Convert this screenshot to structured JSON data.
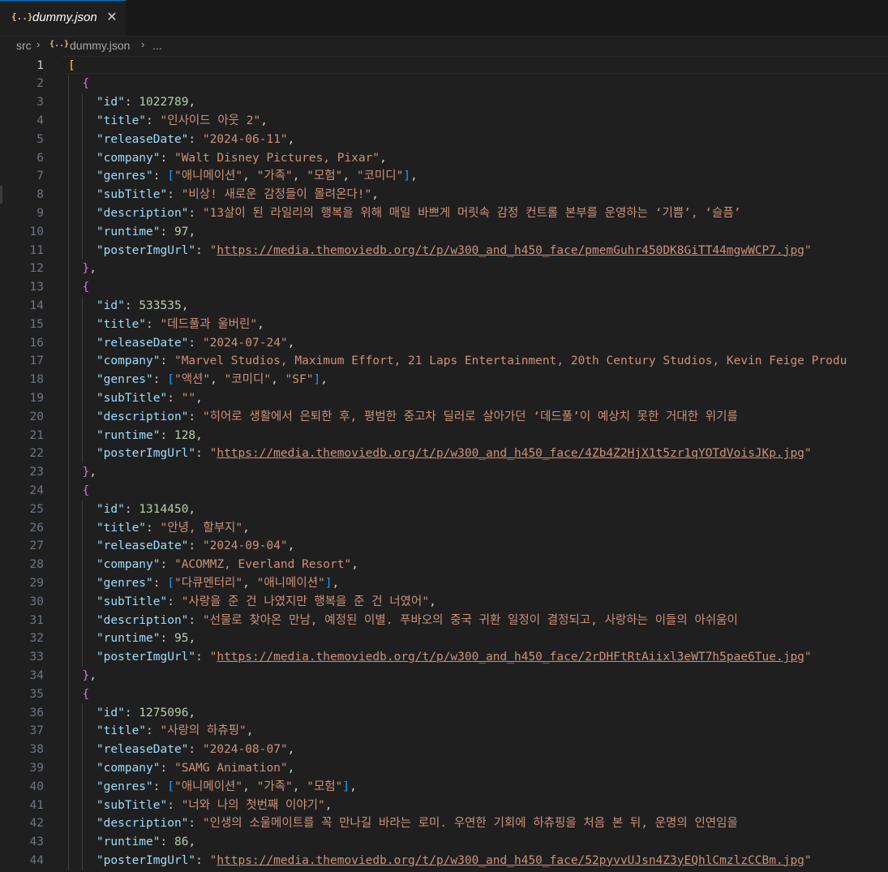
{
  "tab": {
    "icon": "{..}",
    "icon_name": "json-file-icon",
    "label": "dummy.json",
    "close_glyph": "✕"
  },
  "breadcrumb": {
    "folder": "src",
    "file": "dummy.json",
    "more": "...",
    "separator": "›"
  },
  "editor": {
    "active_line": 1,
    "lines": [
      [
        [
          "br1",
          "["
        ]
      ],
      [
        [
          "br2",
          "{"
        ]
      ],
      [
        [
          "key",
          "\"id\""
        ],
        [
          "punc",
          ": "
        ],
        [
          "num",
          "1022789"
        ],
        [
          "punc",
          ","
        ]
      ],
      [
        [
          "key",
          "\"title\""
        ],
        [
          "punc",
          ": "
        ],
        [
          "str",
          "\"인사이드 아웃 2\""
        ],
        [
          "punc",
          ","
        ]
      ],
      [
        [
          "key",
          "\"releaseDate\""
        ],
        [
          "punc",
          ": "
        ],
        [
          "str",
          "\"2024-06-11\""
        ],
        [
          "punc",
          ","
        ]
      ],
      [
        [
          "key",
          "\"company\""
        ],
        [
          "punc",
          ": "
        ],
        [
          "str",
          "\"Walt Disney Pictures, Pixar\""
        ],
        [
          "punc",
          ","
        ]
      ],
      [
        [
          "key",
          "\"genres\""
        ],
        [
          "punc",
          ": "
        ],
        [
          "br3",
          "["
        ],
        [
          "str",
          "\"애니메이션\""
        ],
        [
          "punc",
          ", "
        ],
        [
          "str",
          "\"가족\""
        ],
        [
          "punc",
          ", "
        ],
        [
          "str",
          "\"모험\""
        ],
        [
          "punc",
          ", "
        ],
        [
          "str",
          "\"코미디\""
        ],
        [
          "br3",
          "]"
        ],
        [
          "punc",
          ","
        ]
      ],
      [
        [
          "key",
          "\"subTitle\""
        ],
        [
          "punc",
          ": "
        ],
        [
          "str",
          "\"비상! 새로운 감정들이 몰려온다!\""
        ],
        [
          "punc",
          ","
        ]
      ],
      [
        [
          "key",
          "\"description\""
        ],
        [
          "punc",
          ": "
        ],
        [
          "str",
          "\"13살이 된 라일리의 행복을 위해 매일 바쁘게 머릿속 감정 컨트롤 본부를 운영하는 ‘기쁨’, ‘슬픔’"
        ]
      ],
      [
        [
          "key",
          "\"runtime\""
        ],
        [
          "punc",
          ": "
        ],
        [
          "num",
          "97"
        ],
        [
          "punc",
          ","
        ]
      ],
      [
        [
          "key",
          "\"posterImgUrl\""
        ],
        [
          "punc",
          ": "
        ],
        [
          "str",
          "\""
        ],
        [
          "url",
          "https://media.themoviedb.org/t/p/w300_and_h450_face/pmemGuhr450DK8GiTT44mgwWCP7.jpg"
        ],
        [
          "str",
          "\""
        ]
      ],
      [
        [
          "br2",
          "}"
        ],
        [
          "punc",
          ","
        ]
      ],
      [
        [
          "br2",
          "{"
        ]
      ],
      [
        [
          "key",
          "\"id\""
        ],
        [
          "punc",
          ": "
        ],
        [
          "num",
          "533535"
        ],
        [
          "punc",
          ","
        ]
      ],
      [
        [
          "key",
          "\"title\""
        ],
        [
          "punc",
          ": "
        ],
        [
          "str",
          "\"데드풀과 울버린\""
        ],
        [
          "punc",
          ","
        ]
      ],
      [
        [
          "key",
          "\"releaseDate\""
        ],
        [
          "punc",
          ": "
        ],
        [
          "str",
          "\"2024-07-24\""
        ],
        [
          "punc",
          ","
        ]
      ],
      [
        [
          "key",
          "\"company\""
        ],
        [
          "punc",
          ": "
        ],
        [
          "str",
          "\"Marvel Studios, Maximum Effort, 21 Laps Entertainment, 20th Century Studios, Kevin Feige Produ"
        ]
      ],
      [
        [
          "key",
          "\"genres\""
        ],
        [
          "punc",
          ": "
        ],
        [
          "br3",
          "["
        ],
        [
          "str",
          "\"액션\""
        ],
        [
          "punc",
          ", "
        ],
        [
          "str",
          "\"코미디\""
        ],
        [
          "punc",
          ", "
        ],
        [
          "str",
          "\"SF\""
        ],
        [
          "br3",
          "]"
        ],
        [
          "punc",
          ","
        ]
      ],
      [
        [
          "key",
          "\"subTitle\""
        ],
        [
          "punc",
          ": "
        ],
        [
          "str",
          "\"\""
        ],
        [
          "punc",
          ","
        ]
      ],
      [
        [
          "key",
          "\"description\""
        ],
        [
          "punc",
          ": "
        ],
        [
          "str",
          "\"히어로 생활에서 은퇴한 후, 평범한 중고차 딜러로 살아가던 ‘데드풀’이 예상치 못한 거대한 위기를"
        ]
      ],
      [
        [
          "key",
          "\"runtime\""
        ],
        [
          "punc",
          ": "
        ],
        [
          "num",
          "128"
        ],
        [
          "punc",
          ","
        ]
      ],
      [
        [
          "key",
          "\"posterImgUrl\""
        ],
        [
          "punc",
          ": "
        ],
        [
          "str",
          "\""
        ],
        [
          "url",
          "https://media.themoviedb.org/t/p/w300_and_h450_face/4Zb4Z2HjX1t5zr1qYOTdVoisJKp.jpg"
        ],
        [
          "str",
          "\""
        ]
      ],
      [
        [
          "br2",
          "}"
        ],
        [
          "punc",
          ","
        ]
      ],
      [
        [
          "br2",
          "{"
        ]
      ],
      [
        [
          "key",
          "\"id\""
        ],
        [
          "punc",
          ": "
        ],
        [
          "num",
          "1314450"
        ],
        [
          "punc",
          ","
        ]
      ],
      [
        [
          "key",
          "\"title\""
        ],
        [
          "punc",
          ": "
        ],
        [
          "str",
          "\"안녕, 할부지\""
        ],
        [
          "punc",
          ","
        ]
      ],
      [
        [
          "key",
          "\"releaseDate\""
        ],
        [
          "punc",
          ": "
        ],
        [
          "str",
          "\"2024-09-04\""
        ],
        [
          "punc",
          ","
        ]
      ],
      [
        [
          "key",
          "\"company\""
        ],
        [
          "punc",
          ": "
        ],
        [
          "str",
          "\"ACOMMZ, Everland Resort\""
        ],
        [
          "punc",
          ","
        ]
      ],
      [
        [
          "key",
          "\"genres\""
        ],
        [
          "punc",
          ": "
        ],
        [
          "br3",
          "["
        ],
        [
          "str",
          "\"다큐멘터리\""
        ],
        [
          "punc",
          ", "
        ],
        [
          "str",
          "\"애니메이션\""
        ],
        [
          "br3",
          "]"
        ],
        [
          "punc",
          ","
        ]
      ],
      [
        [
          "key",
          "\"subTitle\""
        ],
        [
          "punc",
          ": "
        ],
        [
          "str",
          "\"사랑을 준 건 나였지만 행복을 준 건 너였어\""
        ],
        [
          "punc",
          ","
        ]
      ],
      [
        [
          "key",
          "\"description\""
        ],
        [
          "punc",
          ": "
        ],
        [
          "str",
          "\"선물로 찾아온 만남, 예정된 이별. 푸바오의 중국 귀환 일정이 결정되고, 사랑하는 이들의 아쉬움이"
        ]
      ],
      [
        [
          "key",
          "\"runtime\""
        ],
        [
          "punc",
          ": "
        ],
        [
          "num",
          "95"
        ],
        [
          "punc",
          ","
        ]
      ],
      [
        [
          "key",
          "\"posterImgUrl\""
        ],
        [
          "punc",
          ": "
        ],
        [
          "str",
          "\""
        ],
        [
          "url",
          "https://media.themoviedb.org/t/p/w300_and_h450_face/2rDHFtRtAiixl3eWT7h5pae6Tue.jpg"
        ],
        [
          "str",
          "\""
        ]
      ],
      [
        [
          "br2",
          "}"
        ],
        [
          "punc",
          ","
        ]
      ],
      [
        [
          "br2",
          "{"
        ]
      ],
      [
        [
          "key",
          "\"id\""
        ],
        [
          "punc",
          ": "
        ],
        [
          "num",
          "1275096"
        ],
        [
          "punc",
          ","
        ]
      ],
      [
        [
          "key",
          "\"title\""
        ],
        [
          "punc",
          ": "
        ],
        [
          "str",
          "\"사랑의 하츄핑\""
        ],
        [
          "punc",
          ","
        ]
      ],
      [
        [
          "key",
          "\"releaseDate\""
        ],
        [
          "punc",
          ": "
        ],
        [
          "str",
          "\"2024-08-07\""
        ],
        [
          "punc",
          ","
        ]
      ],
      [
        [
          "key",
          "\"company\""
        ],
        [
          "punc",
          ": "
        ],
        [
          "str",
          "\"SAMG Animation\""
        ],
        [
          "punc",
          ","
        ]
      ],
      [
        [
          "key",
          "\"genres\""
        ],
        [
          "punc",
          ": "
        ],
        [
          "br3",
          "["
        ],
        [
          "str",
          "\"애니메이션\""
        ],
        [
          "punc",
          ", "
        ],
        [
          "str",
          "\"가족\""
        ],
        [
          "punc",
          ", "
        ],
        [
          "str",
          "\"모험\""
        ],
        [
          "br3",
          "]"
        ],
        [
          "punc",
          ","
        ]
      ],
      [
        [
          "key",
          "\"subTitle\""
        ],
        [
          "punc",
          ": "
        ],
        [
          "str",
          "\"너와 나의 첫번째 이야기\""
        ],
        [
          "punc",
          ","
        ]
      ],
      [
        [
          "key",
          "\"description\""
        ],
        [
          "punc",
          ": "
        ],
        [
          "str",
          "\"인생의 소울메이트를 꼭 만나길 바라는 로미. 우연한 기회에 하츄핑을 처음 본 뒤, 운명의 인연임을"
        ]
      ],
      [
        [
          "key",
          "\"runtime\""
        ],
        [
          "punc",
          ": "
        ],
        [
          "num",
          "86"
        ],
        [
          "punc",
          ","
        ]
      ],
      [
        [
          "key",
          "\"posterImgUrl\""
        ],
        [
          "punc",
          ": "
        ],
        [
          "str",
          "\""
        ],
        [
          "url",
          "https://media.themoviedb.org/t/p/w300_and_h450_face/52pyvvUJsn4Z3yEQhlCmzlzCCBm.jpg"
        ],
        [
          "str",
          "\""
        ]
      ]
    ]
  },
  "colors": {
    "background": "#1f1f1f",
    "key": "#9cdcfe",
    "string": "#ce9178",
    "number": "#b5cea8",
    "bracket_level1": "#ffd700",
    "bracket_level2": "#da70d6",
    "bracket_level3": "#179fff"
  }
}
